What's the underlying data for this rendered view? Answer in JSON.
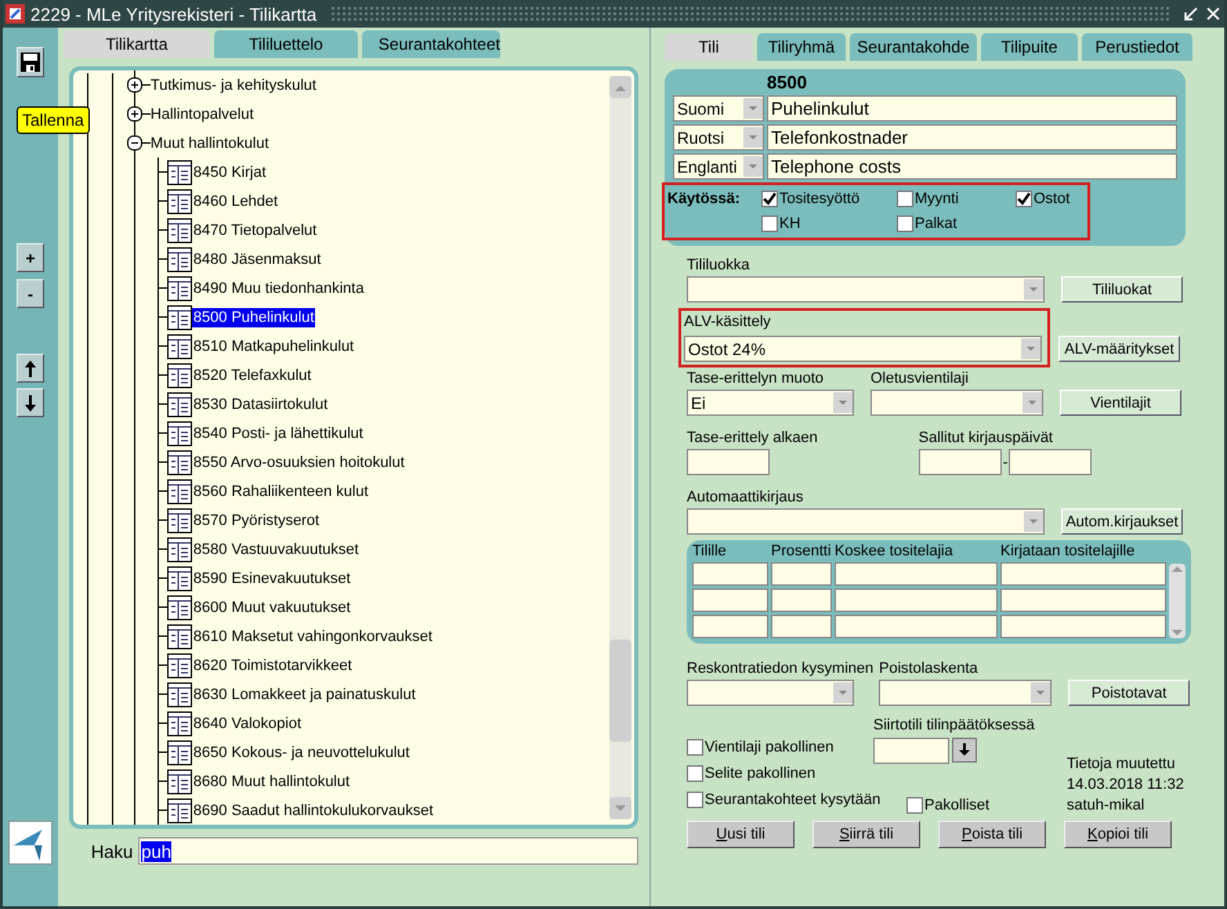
{
  "window": {
    "title": "2229 - MLe Yritysrekisteri - Tilikartta"
  },
  "toolbar": {
    "tooltip": "Tallenna",
    "buttons": [
      {
        "label": "+"
      },
      {
        "label": "-"
      }
    ]
  },
  "left_tabs": [
    {
      "label": "Tilikartta",
      "selected": true
    },
    {
      "label": "Tililuettelo",
      "selected": false
    },
    {
      "label": "Seurantakohteet",
      "selected": false
    }
  ],
  "tree": [
    {
      "label": "Tutkimus- ja kehityskulut",
      "expanded": false
    },
    {
      "label": "Hallintopalvelut",
      "expanded": false
    },
    {
      "label": "Muut hallintokulut",
      "expanded": true,
      "children": [
        {
          "label": "8450 Kirjat",
          "selected": false
        },
        {
          "label": "8460 Lehdet",
          "selected": false
        },
        {
          "label": "8470 Tietopalvelut",
          "selected": false
        },
        {
          "label": "8480 Jäsenmaksut",
          "selected": false
        },
        {
          "label": "8490 Muu tiedonhankinta",
          "selected": false
        },
        {
          "label": "8500 Puhelinkulut",
          "selected": true
        },
        {
          "label": "8510 Matkapuhelinkulut",
          "selected": false
        },
        {
          "label": "8520 Telefaxkulut",
          "selected": false
        },
        {
          "label": "8530 Datasiirtokulut",
          "selected": false
        },
        {
          "label": "8540 Posti- ja lähettikulut",
          "selected": false
        },
        {
          "label": "8550 Arvo-osuuksien hoitokulut",
          "selected": false
        },
        {
          "label": "8560 Rahaliikenteen kulut",
          "selected": false
        },
        {
          "label": "8570 Pyöristyserot",
          "selected": false
        },
        {
          "label": "8580 Vastuuvakuutukset",
          "selected": false
        },
        {
          "label": "8590 Esinevakuutukset",
          "selected": false
        },
        {
          "label": "8600 Muut vakuutukset",
          "selected": false
        },
        {
          "label": "8610 Maksetut vahingonkorvaukset",
          "selected": false
        },
        {
          "label": "8620 Toimistotarvikkeet",
          "selected": false
        },
        {
          "label": "8630 Lomakkeet ja painatuskulut",
          "selected": false
        },
        {
          "label": "8640 Valokopiot",
          "selected": false
        },
        {
          "label": "8650 Kokous- ja neuvottelukulut",
          "selected": false
        },
        {
          "label": "8680 Muut hallintokulut",
          "selected": false
        },
        {
          "label": "8690 Saadut hallintokulukorvaukset",
          "selected": false
        }
      ]
    }
  ],
  "search": {
    "label": "Haku",
    "value": "puh"
  },
  "right_tabs": [
    {
      "label": "Tili",
      "selected": true
    },
    {
      "label": "Tiliryhmä",
      "selected": false
    },
    {
      "label": "Seurantakohde",
      "selected": false
    },
    {
      "label": "Tilipuite",
      "selected": false
    },
    {
      "label": "Perustiedot",
      "selected": false
    }
  ],
  "account": {
    "number": "8500",
    "names": [
      {
        "language": "Suomi",
        "value": "Puhelinkulut"
      },
      {
        "language": "Ruotsi",
        "value": "Telefonkostnader"
      },
      {
        "language": "Englanti",
        "value": "Telephone costs"
      }
    ],
    "in_use": {
      "label": "Käytössä:",
      "highlighted": true,
      "options": [
        {
          "label": "Tositesyöttö",
          "checked": true
        },
        {
          "label": "Myynti",
          "checked": false
        },
        {
          "label": "Ostot",
          "checked": true
        },
        {
          "label": "KH",
          "checked": false
        },
        {
          "label": "Palkat",
          "checked": false
        }
      ]
    }
  },
  "account_class": {
    "label": "Tililuokka",
    "button": "Tililuokat"
  },
  "vat": {
    "label": "ALV-käsittely",
    "value": "Ostot 24%",
    "button": "ALV-määritykset",
    "highlighted": true
  },
  "balance_spec": {
    "label": "Tase-erittelyn muoto",
    "value": "Ei"
  },
  "default_entry_type": {
    "label": "Oletusvientilaji",
    "button": "Vientilajit"
  },
  "balance_spec_start": {
    "label": "Tase-erittely alkaen"
  },
  "allowed_dates": {
    "label": "Sallitut kirjauspäivät",
    "separator": "-"
  },
  "auto_entry": {
    "label": "Automaattikirjaus",
    "button": "Autom.kirjaukset"
  },
  "auto_table": {
    "columns": [
      "Tilille",
      "Prosentti",
      "Koskee tositelajia",
      "Kirjataan tositelajille"
    ],
    "rows": [
      {
        "kind": "blank"
      },
      {
        "kind": "blank"
      },
      {
        "kind": "blank"
      }
    ]
  },
  "ledger_query": {
    "label": "Reskontratiedon kysyminen"
  },
  "depreciation": {
    "label": "Poistolaskenta",
    "button": "Poistotavat"
  },
  "transfer_account": {
    "label": "Siirtotili tilinpäätöksessä"
  },
  "flags": [
    {
      "label": "Vientilaji pakollinen",
      "checked": false
    },
    {
      "label": "Selite pakollinen",
      "checked": false
    },
    {
      "label": "Seurantakohteet kysytään",
      "checked": false
    },
    {
      "label": "Pakolliset",
      "checked": false
    }
  ],
  "modified": {
    "label": "Tietoja muutettu",
    "date": "14.03.2018 11:32",
    "user": "satuh-mikal"
  },
  "actions": [
    {
      "mnemonic": "U",
      "rest": "usi tili"
    },
    {
      "mnemonic": "S",
      "rest": "iirrä tili"
    },
    {
      "mnemonic": "P",
      "rest": "oista tili"
    },
    {
      "mnemonic": "K",
      "rest": "opioi tili"
    }
  ]
}
